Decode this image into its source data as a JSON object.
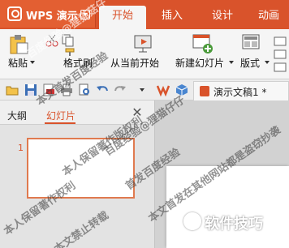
{
  "app": {
    "name": "WPS 演示"
  },
  "tabs": [
    "开始",
    "插入",
    "设计",
    "动画"
  ],
  "ribbon": {
    "paste": "粘贴",
    "format_painter": "格式刷",
    "from_current": "从当前开始",
    "new_slide": "新建幻灯片",
    "layout": "版式"
  },
  "document": {
    "title": "演示文稿1 *"
  },
  "panel": {
    "outline_tab": "大纲",
    "slides_tab": "幻灯片",
    "close": "✕"
  },
  "slides": [
    {
      "number": "1"
    }
  ],
  "watermarks": [
    "百度经验@狸猫菇仔",
    "本文首发百度经验",
    "本人保留著作版权利",
    "百度经验@狸猫仔仔",
    "首发百度经验",
    "本文禁止转载",
    "本文首发在其他网站都是盗窃抄袭",
    "本人保留著作权利"
  ],
  "brand": {
    "text": "软件技巧"
  },
  "colors": {
    "accent": "#d9532b",
    "tab_bg": "#f5f5f5"
  }
}
